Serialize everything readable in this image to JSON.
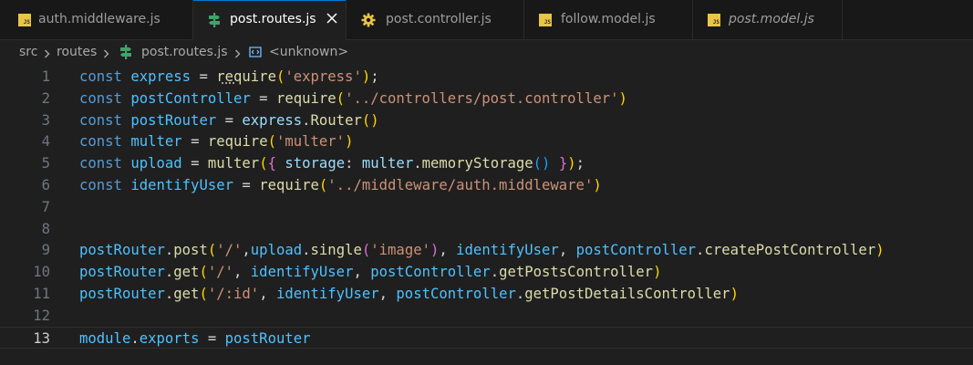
{
  "tabs": [
    {
      "label": "auth.middleware.js",
      "icon": "js-icon",
      "active": false
    },
    {
      "label": "post.routes.js",
      "icon": "route-icon",
      "active": true
    },
    {
      "label": "post.controller.js",
      "icon": "gear-icon",
      "active": false
    },
    {
      "label": "follow.model.js",
      "icon": "js-icon",
      "active": false
    },
    {
      "label": "post.model.js",
      "icon": "js-icon",
      "active": false,
      "italic": true
    }
  ],
  "breadcrumb": {
    "items": [
      "src",
      "routes",
      "post.routes.js",
      "<unknown>"
    ]
  },
  "editor": {
    "current_line": 13,
    "lines": [
      {
        "num": "1",
        "tokens": [
          [
            "kw",
            "const"
          ],
          [
            "plain",
            " "
          ],
          [
            "var",
            "express"
          ],
          [
            "plain",
            " = "
          ],
          [
            "fn",
            "require"
          ],
          [
            "b1",
            "("
          ],
          [
            "str",
            "'express'"
          ],
          [
            "b1",
            ")"
          ],
          [
            "plain",
            ";"
          ]
        ]
      },
      {
        "num": "2",
        "tokens": [
          [
            "kw",
            "const"
          ],
          [
            "plain",
            " "
          ],
          [
            "var",
            "postController"
          ],
          [
            "plain",
            " = "
          ],
          [
            "fn",
            "require"
          ],
          [
            "b1",
            "("
          ],
          [
            "str",
            "'../controllers/post.controller'"
          ],
          [
            "b1",
            ")"
          ]
        ]
      },
      {
        "num": "3",
        "tokens": [
          [
            "kw",
            "const"
          ],
          [
            "plain",
            " "
          ],
          [
            "var",
            "postRouter"
          ],
          [
            "plain",
            " = "
          ],
          [
            "prop",
            "express"
          ],
          [
            "plain",
            "."
          ],
          [
            "fn",
            "Router"
          ],
          [
            "b1",
            "()"
          ]
        ]
      },
      {
        "num": "4",
        "tokens": [
          [
            "kw",
            "const"
          ],
          [
            "plain",
            " "
          ],
          [
            "var",
            "multer"
          ],
          [
            "plain",
            " = "
          ],
          [
            "fn",
            "require"
          ],
          [
            "b1",
            "("
          ],
          [
            "str",
            "'multer'"
          ],
          [
            "b1",
            ")"
          ]
        ]
      },
      {
        "num": "5",
        "tokens": [
          [
            "kw",
            "const"
          ],
          [
            "plain",
            " "
          ],
          [
            "var",
            "upload"
          ],
          [
            "plain",
            " = "
          ],
          [
            "fn",
            "multer"
          ],
          [
            "b1",
            "("
          ],
          [
            "b2",
            "{"
          ],
          [
            "plain",
            " "
          ],
          [
            "prop",
            "storage"
          ],
          [
            "plain",
            ": "
          ],
          [
            "prop",
            "multer"
          ],
          [
            "plain",
            "."
          ],
          [
            "fn",
            "memoryStorage"
          ],
          [
            "b3",
            "()"
          ],
          [
            "plain",
            " "
          ],
          [
            "b2",
            "}"
          ],
          [
            "b1",
            ")"
          ],
          [
            "plain",
            ";"
          ]
        ]
      },
      {
        "num": "6",
        "tokens": [
          [
            "kw",
            "const"
          ],
          [
            "plain",
            " "
          ],
          [
            "var",
            "identifyUser"
          ],
          [
            "plain",
            " = "
          ],
          [
            "fn",
            "require"
          ],
          [
            "b1",
            "("
          ],
          [
            "str",
            "'../middleware/auth.middleware'"
          ],
          [
            "b1",
            ")"
          ]
        ]
      },
      {
        "num": "7",
        "tokens": []
      },
      {
        "num": "8",
        "tokens": []
      },
      {
        "num": "9",
        "tokens": [
          [
            "var",
            "postRouter"
          ],
          [
            "plain",
            "."
          ],
          [
            "fn",
            "post"
          ],
          [
            "b1",
            "("
          ],
          [
            "str",
            "'/'"
          ],
          [
            "plain",
            ","
          ],
          [
            "var",
            "upload"
          ],
          [
            "plain",
            "."
          ],
          [
            "fn",
            "single"
          ],
          [
            "b2",
            "("
          ],
          [
            "str",
            "'image'"
          ],
          [
            "b2",
            ")"
          ],
          [
            "plain",
            ", "
          ],
          [
            "var",
            "identifyUser"
          ],
          [
            "plain",
            ", "
          ],
          [
            "var",
            "postController"
          ],
          [
            "plain",
            "."
          ],
          [
            "fn",
            "createPostController"
          ],
          [
            "b1",
            ")"
          ]
        ]
      },
      {
        "num": "10",
        "tokens": [
          [
            "var",
            "postRouter"
          ],
          [
            "plain",
            "."
          ],
          [
            "fn",
            "get"
          ],
          [
            "b1",
            "("
          ],
          [
            "str",
            "'/'"
          ],
          [
            "plain",
            ", "
          ],
          [
            "var",
            "identifyUser"
          ],
          [
            "plain",
            ", "
          ],
          [
            "var",
            "postController"
          ],
          [
            "plain",
            "."
          ],
          [
            "fn",
            "getPostsController"
          ],
          [
            "b1",
            ")"
          ]
        ]
      },
      {
        "num": "11",
        "tokens": [
          [
            "var",
            "postRouter"
          ],
          [
            "plain",
            "."
          ],
          [
            "fn",
            "get"
          ],
          [
            "b1",
            "("
          ],
          [
            "str",
            "'/:id'"
          ],
          [
            "plain",
            ", "
          ],
          [
            "var",
            "identifyUser"
          ],
          [
            "plain",
            ", "
          ],
          [
            "var",
            "postController"
          ],
          [
            "plain",
            "."
          ],
          [
            "fn",
            "getPostDetailsController"
          ],
          [
            "b1",
            ")"
          ]
        ]
      },
      {
        "num": "12",
        "tokens": []
      },
      {
        "num": "13",
        "tokens": [
          [
            "var",
            "module"
          ],
          [
            "plain",
            "."
          ],
          [
            "var",
            "exports"
          ],
          [
            "plain",
            " = "
          ],
          [
            "var",
            "postRouter"
          ]
        ]
      }
    ]
  }
}
